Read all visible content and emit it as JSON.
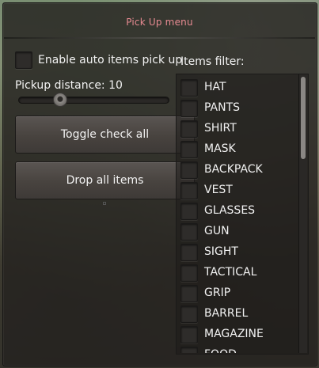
{
  "window": {
    "title": "Pick Up menu"
  },
  "auto_pickup": {
    "label": "Enable auto items pick up",
    "checked": false
  },
  "pickup_distance": {
    "label": "Pickup distance: 10",
    "value": 10,
    "fraction": 0.28
  },
  "buttons": {
    "toggle_check_all": "Toggle check all",
    "drop_all": "Drop all items"
  },
  "filter": {
    "title": "Items filter:",
    "items": [
      {
        "label": "HAT",
        "checked": false
      },
      {
        "label": "PANTS",
        "checked": false
      },
      {
        "label": "SHIRT",
        "checked": false
      },
      {
        "label": "MASK",
        "checked": false
      },
      {
        "label": "BACKPACK",
        "checked": false
      },
      {
        "label": "VEST",
        "checked": false
      },
      {
        "label": "GLASSES",
        "checked": false
      },
      {
        "label": "GUN",
        "checked": false
      },
      {
        "label": "SIGHT",
        "checked": false
      },
      {
        "label": "TACTICAL",
        "checked": false
      },
      {
        "label": "GRIP",
        "checked": false
      },
      {
        "label": "BARREL",
        "checked": false
      },
      {
        "label": "MAGAZINE",
        "checked": false
      },
      {
        "label": "FOOD",
        "checked": false
      }
    ]
  },
  "colors": {
    "title": "#e88b92",
    "text": "#f2f2f2"
  }
}
